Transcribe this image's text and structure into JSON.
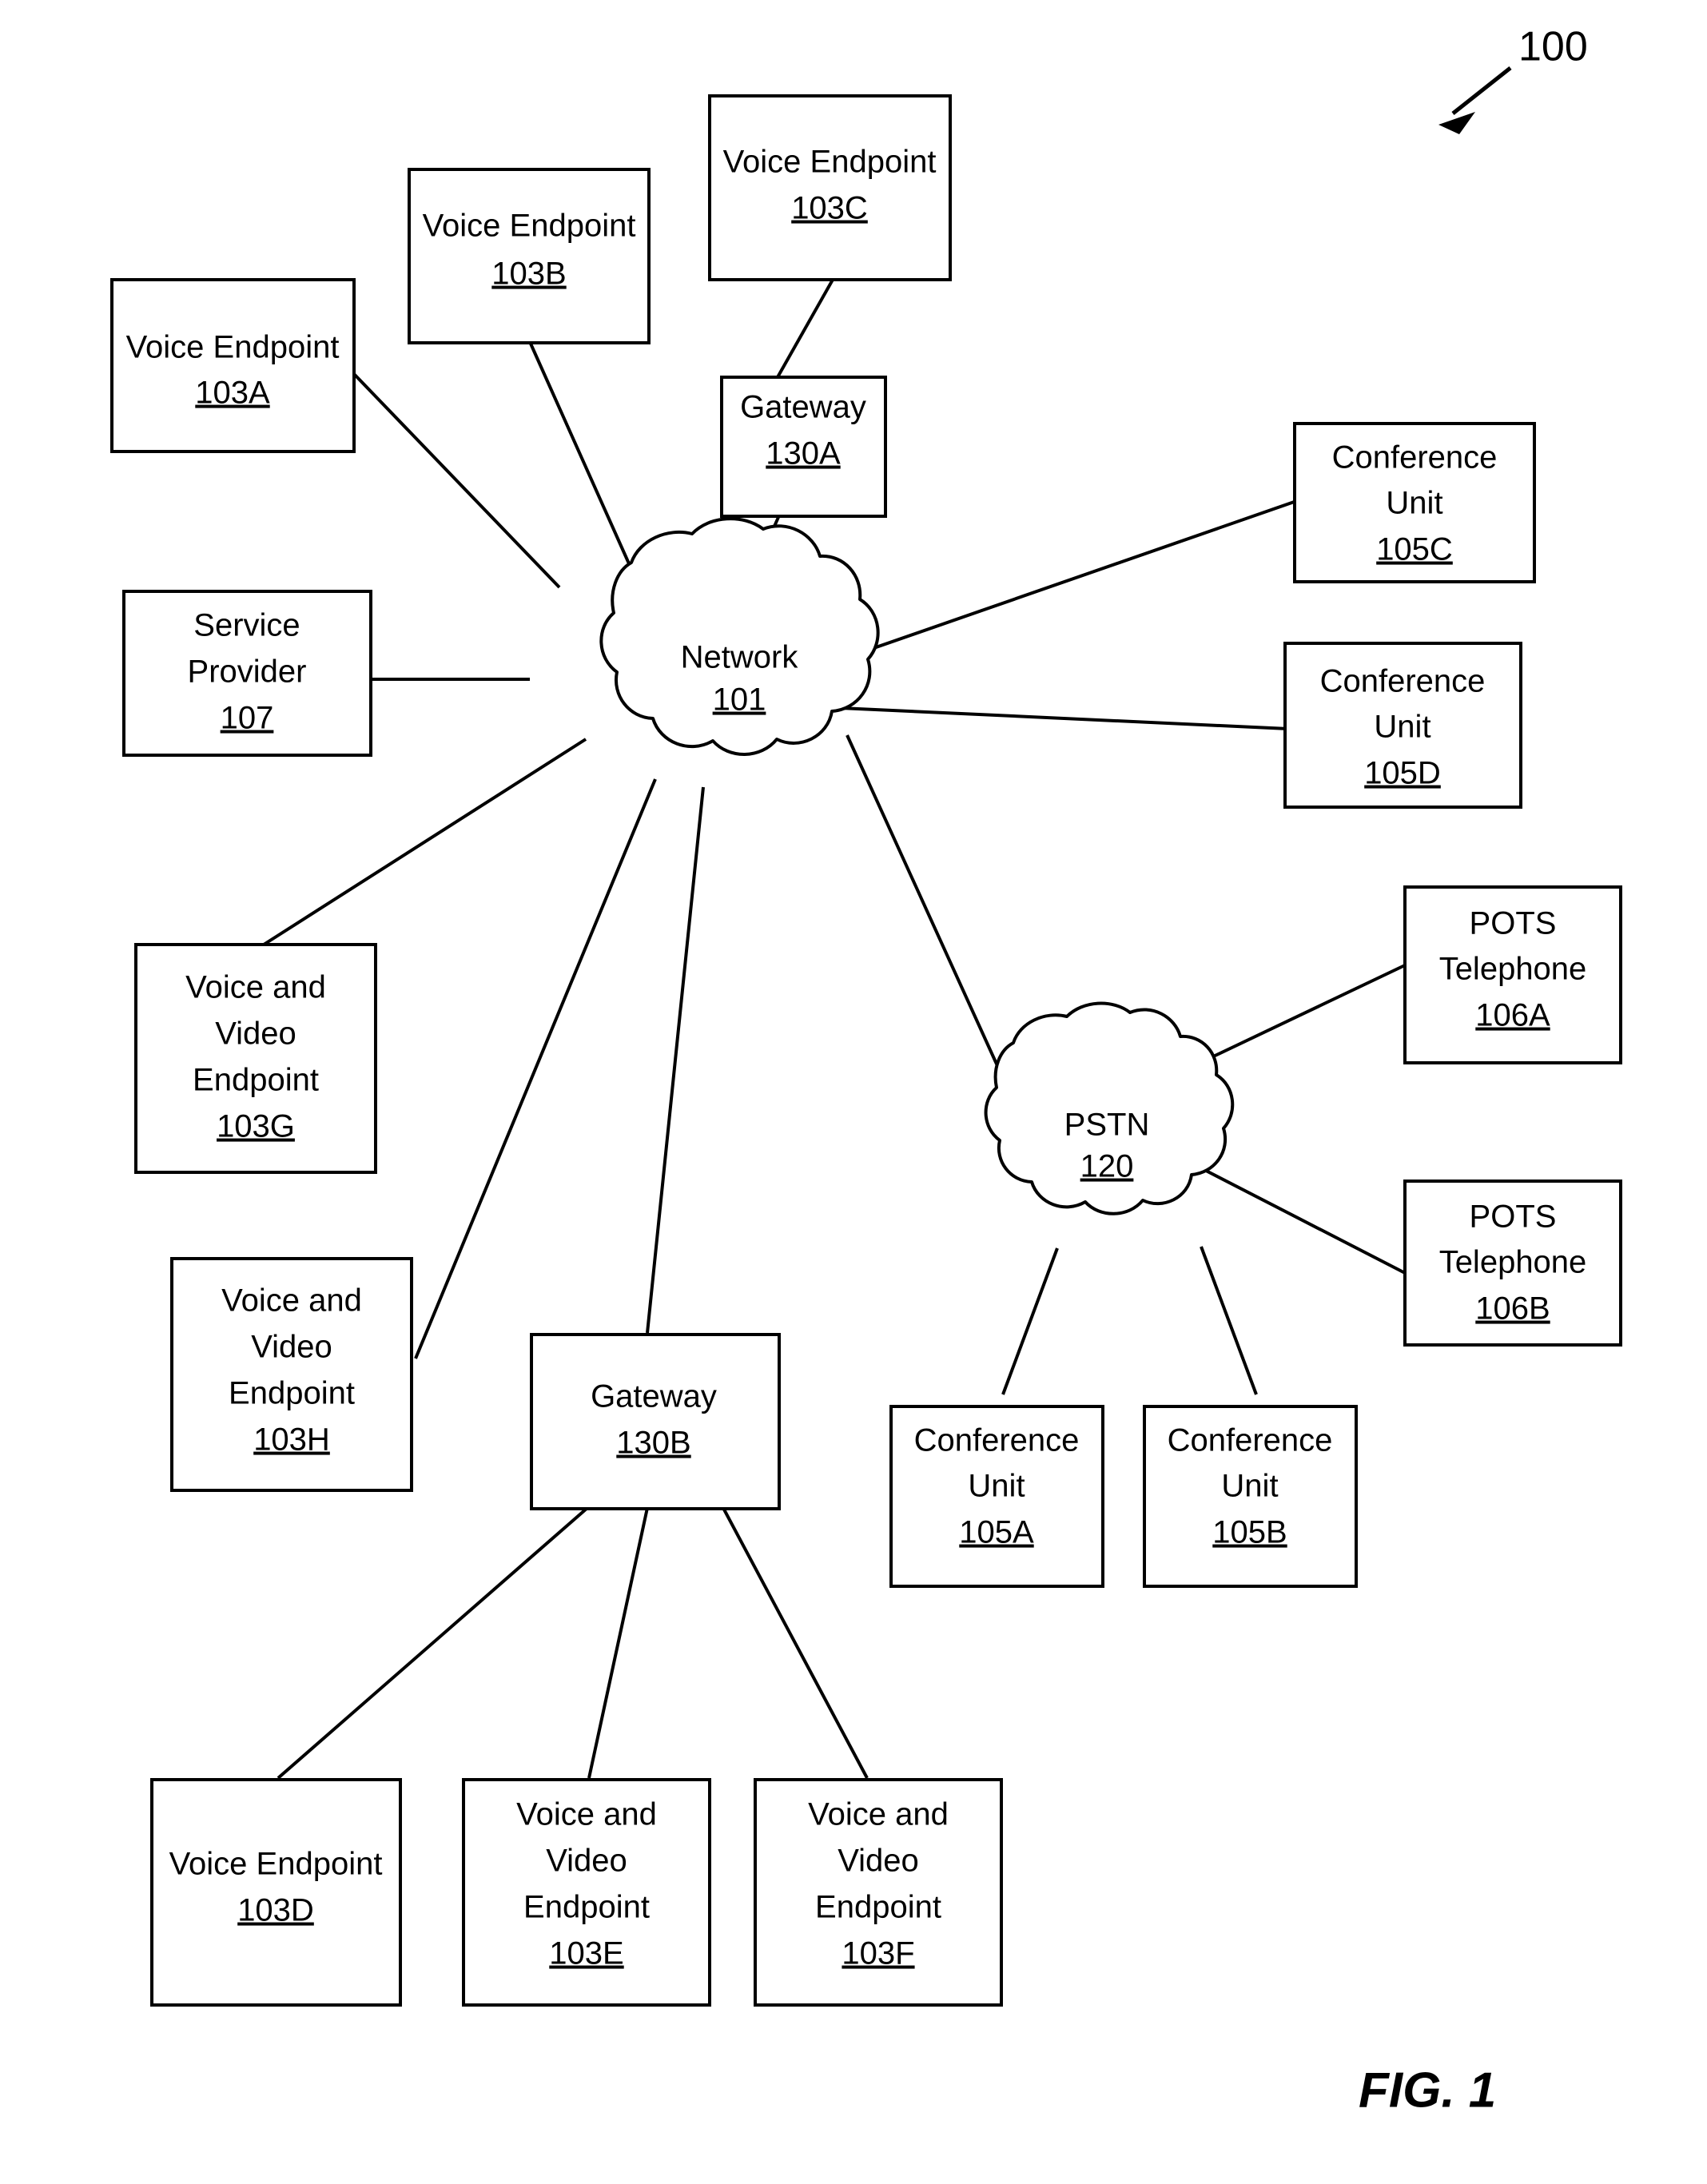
{
  "figure": {
    "number_label": "100",
    "caption": "FIG. 1"
  },
  "clouds": [
    {
      "id": "network",
      "label": "Network",
      "ref": "101"
    },
    {
      "id": "pstn",
      "label": "PSTN",
      "ref": "120"
    }
  ],
  "nodes": [
    {
      "id": "ve-103a",
      "lines": [
        "Voice Endpoint"
      ],
      "ref": "103A"
    },
    {
      "id": "ve-103b",
      "lines": [
        "Voice Endpoint"
      ],
      "ref": "103B"
    },
    {
      "id": "ve-103c",
      "lines": [
        "Voice Endpoint"
      ],
      "ref": "103C"
    },
    {
      "id": "gw-130a",
      "lines": [
        "Gateway"
      ],
      "ref": "130A"
    },
    {
      "id": "cu-105c",
      "lines": [
        "Conference",
        "Unit"
      ],
      "ref": "105C"
    },
    {
      "id": "cu-105d",
      "lines": [
        "Conference",
        "Unit"
      ],
      "ref": "105D"
    },
    {
      "id": "sp-107",
      "lines": [
        "Service",
        "Provider"
      ],
      "ref": "107"
    },
    {
      "id": "vve-103g",
      "lines": [
        "Voice and",
        "Video",
        "Endpoint"
      ],
      "ref": "103G"
    },
    {
      "id": "vve-103h",
      "lines": [
        "Voice and",
        "Video",
        "Endpoint"
      ],
      "ref": "103H"
    },
    {
      "id": "pots-106a",
      "lines": [
        "POTS",
        "Telephone"
      ],
      "ref": "106A"
    },
    {
      "id": "pots-106b",
      "lines": [
        "POTS",
        "Telephone"
      ],
      "ref": "106B"
    },
    {
      "id": "cu-105a",
      "lines": [
        "Conference",
        "Unit"
      ],
      "ref": "105A"
    },
    {
      "id": "cu-105b",
      "lines": [
        "Conference",
        "Unit"
      ],
      "ref": "105B"
    },
    {
      "id": "gw-130b",
      "lines": [
        "Gateway"
      ],
      "ref": "130B"
    },
    {
      "id": "ve-103d",
      "lines": [
        "Voice Endpoint"
      ],
      "ref": "103D"
    },
    {
      "id": "vve-103e",
      "lines": [
        "Voice and",
        "Video",
        "Endpoint"
      ],
      "ref": "103E"
    },
    {
      "id": "vve-103f",
      "lines": [
        "Voice and",
        "Video",
        "Endpoint"
      ],
      "ref": "103F"
    }
  ],
  "connections": [
    {
      "from": "ve-103a",
      "to": "network"
    },
    {
      "from": "ve-103b",
      "to": "network"
    },
    {
      "from": "ve-103c",
      "to": "gw-130a"
    },
    {
      "from": "gw-130a",
      "to": "network"
    },
    {
      "from": "cu-105c",
      "to": "network"
    },
    {
      "from": "cu-105d",
      "to": "network"
    },
    {
      "from": "sp-107",
      "to": "network"
    },
    {
      "from": "vve-103g",
      "to": "network"
    },
    {
      "from": "vve-103h",
      "to": "network"
    },
    {
      "from": "network",
      "to": "pstn"
    },
    {
      "from": "network",
      "to": "gw-130b"
    },
    {
      "from": "pots-106a",
      "to": "pstn"
    },
    {
      "from": "pots-106b",
      "to": "pstn"
    },
    {
      "from": "cu-105a",
      "to": "pstn"
    },
    {
      "from": "cu-105b",
      "to": "pstn"
    },
    {
      "from": "gw-130b",
      "to": "ve-103d"
    },
    {
      "from": "gw-130b",
      "to": "vve-103e"
    },
    {
      "from": "gw-130b",
      "to": "vve-103f"
    }
  ]
}
